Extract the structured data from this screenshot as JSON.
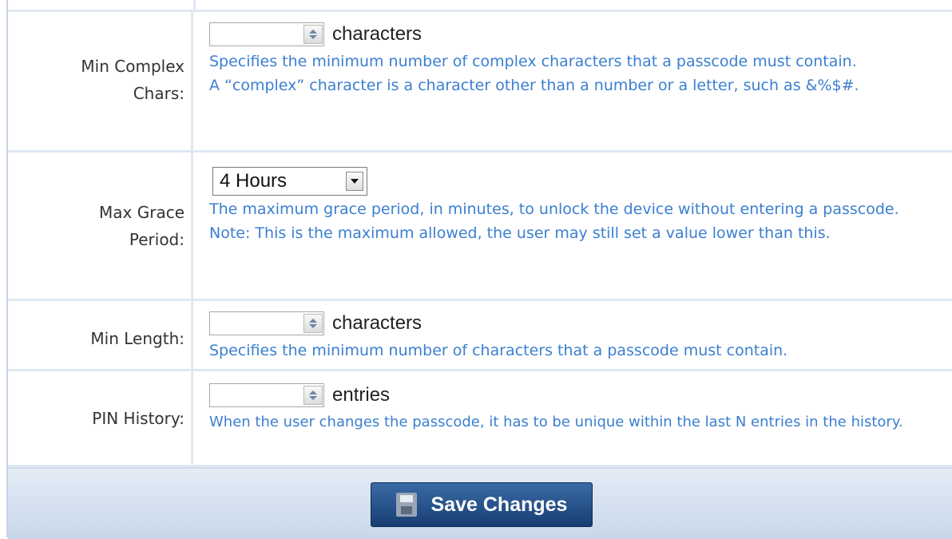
{
  "rows": [
    {
      "label": "Min Complex Chars:",
      "control": "spinner",
      "value": "",
      "unit": "characters",
      "help": [
        "Specifies the minimum number of complex characters that a passcode must contain.",
        "A “complex” character is a character other than a number or a letter, such as &%$#."
      ]
    },
    {
      "label": "Max Grace Period:",
      "control": "select",
      "value": "4 Hours",
      "help": [
        "The maximum grace period, in minutes, to unlock the device without entering a passcode.",
        "Note: This is the maximum allowed, the user may still set a value lower than this."
      ]
    },
    {
      "label": "Min Length:",
      "control": "spinner",
      "value": "",
      "unit": "characters",
      "help": [
        "Specifies the minimum number of characters that a passcode must contain."
      ]
    },
    {
      "label": "PIN History:",
      "control": "spinner",
      "value": "",
      "unit": "entries",
      "help": [
        "When the user changes the passcode, it has to be unique within the last N entries in the history."
      ]
    }
  ],
  "footer": {
    "save_label": "Save Changes",
    "save_icon": "floppy-disk-icon"
  },
  "colors": {
    "help_text": "#3b7fd0",
    "row_border": "#dfe7f3",
    "button_bg": "#1f4b85",
    "footer_bg": "#d6e2f1"
  }
}
